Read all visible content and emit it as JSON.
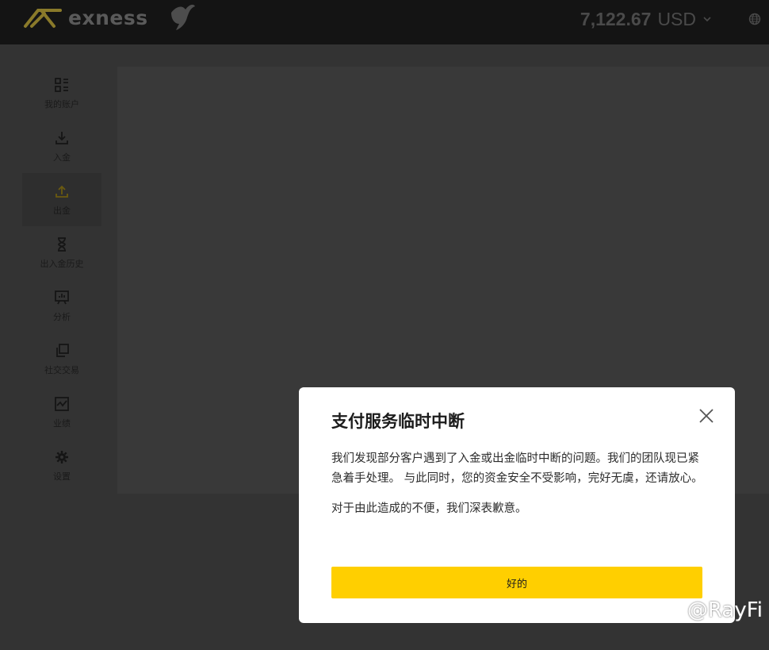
{
  "header": {
    "brand": "exness",
    "balance_amount": "7,122.67",
    "balance_currency": "USD",
    "icons": [
      "exness-logo-mark",
      "dove-icon",
      "chevron-down-icon",
      "globe-icon"
    ]
  },
  "sidebar": {
    "items": [
      {
        "label": "我的账户",
        "icon": "grid-icon",
        "active": false
      },
      {
        "label": "入金",
        "icon": "download-icon",
        "active": false
      },
      {
        "label": "出金",
        "icon": "withdraw-icon",
        "active": true
      },
      {
        "label": "出入金历史",
        "icon": "hourglass-icon",
        "active": false
      },
      {
        "label": "分析",
        "icon": "analytics-icon",
        "active": false
      },
      {
        "label": "社交交易",
        "icon": "copy-icon",
        "active": false
      },
      {
        "label": "业绩",
        "icon": "performance-chart-icon",
        "active": false
      },
      {
        "label": "设置",
        "icon": "gear-icon",
        "active": false
      }
    ]
  },
  "modal": {
    "title": "支付服务临时中断",
    "paragraph1": "我们发现部分客户遇到了入金或出金临时中断的问题。我们的团队现已紧急着手处理。 与此同时，您的资金安全不受影响，完好无虞，还请放心。",
    "paragraph2": "对于由此造成的不便，我们深表歉意。",
    "ok_label": "好的"
  },
  "watermark": {
    "text": "@RayFi"
  },
  "colors": {
    "accent": "#ffcf00",
    "topbar": "#141414",
    "overlay": "#333333",
    "modal_bg": "#ffffff"
  }
}
